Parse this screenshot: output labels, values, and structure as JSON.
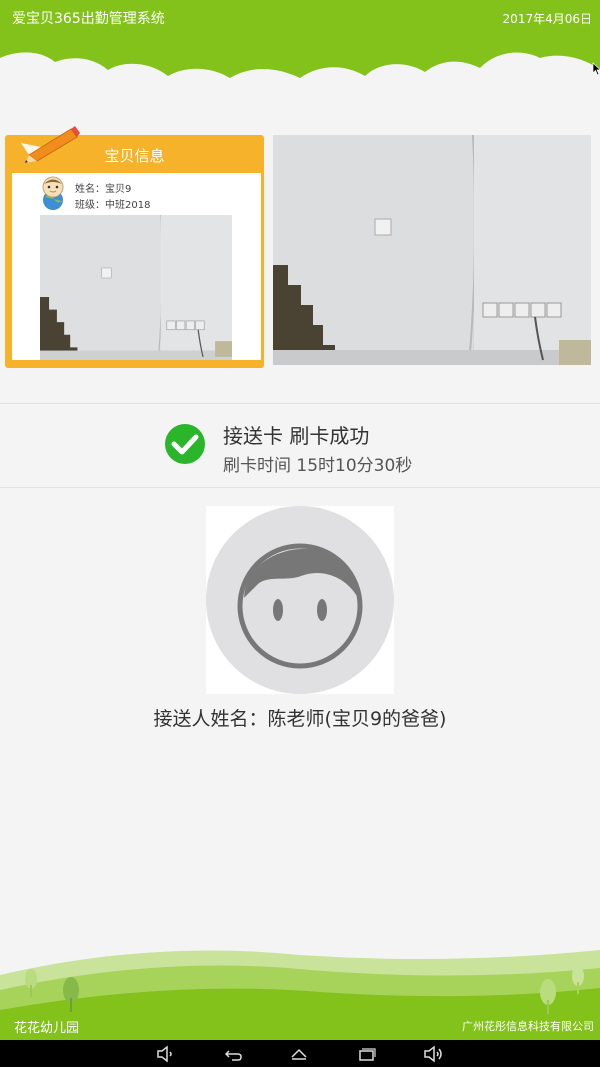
{
  "header": {
    "app_title": "爱宝贝365出勤管理系统",
    "date": "2017年4月06日"
  },
  "baby_info": {
    "title": "宝贝信息",
    "name_line": "姓名：宝贝9",
    "class_line": "班级：中班2018"
  },
  "status": {
    "line1": "接送卡 刷卡成功",
    "line2": "刷卡时间 15时10分30秒"
  },
  "pickup_person": {
    "name_line": "接送人姓名：陈老师(宝贝9的爸爸)"
  },
  "footer": {
    "school_name": "花花幼儿园",
    "company_name": "广州花彤信息科技有限公司"
  },
  "colors": {
    "brand_green": "#82c21a",
    "card_orange": "#f6b22a",
    "success_green": "#2ab52a"
  },
  "icons": [
    "pencil-icon",
    "baby-avatar-icon",
    "check-circle-icon",
    "default-avatar-icon",
    "volume-down-icon",
    "back-icon",
    "home-icon",
    "recent-apps-icon",
    "volume-up-icon",
    "cursor-icon"
  ]
}
